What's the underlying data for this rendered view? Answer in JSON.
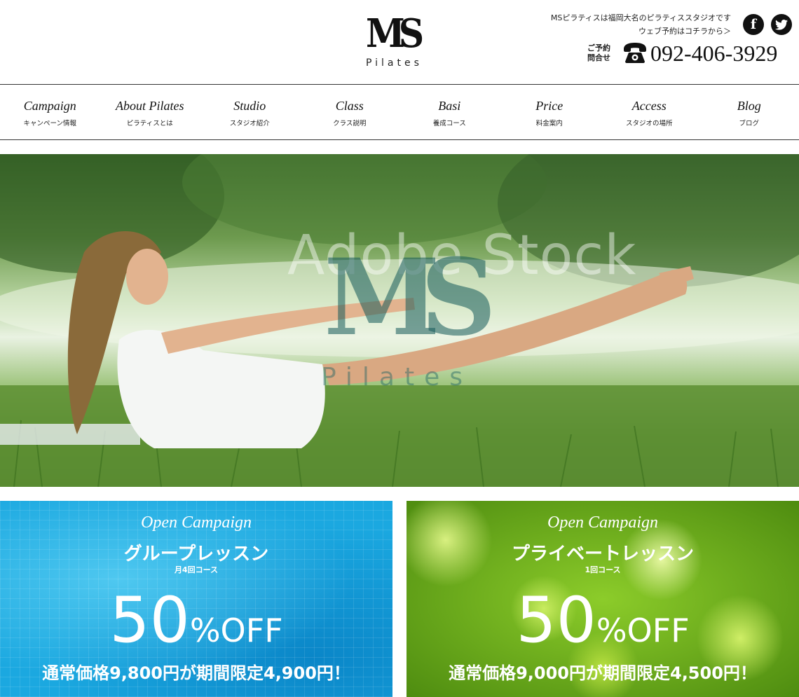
{
  "header": {
    "logo": {
      "mark": "MS",
      "sub": "Pilates"
    },
    "tagline": "MSピラティスは福岡大名のピラティススタジオです",
    "reserve_link": "ウェブ予約はコチラから＞",
    "contact_label_1": "ご予約",
    "contact_label_2": "問合せ",
    "phone": "092-406-3929",
    "social": {
      "facebook": "f",
      "twitter_icon": "twitter-bird"
    }
  },
  "nav": [
    {
      "en": "Campaign",
      "ja": "キャンペーン情報"
    },
    {
      "en": "About Pilates",
      "ja": "ピラティスとは"
    },
    {
      "en": "Studio",
      "ja": "スタジオ紹介"
    },
    {
      "en": "Class",
      "ja": "クラス説明"
    },
    {
      "en": "Basi",
      "ja": "養成コース"
    },
    {
      "en": "Price",
      "ja": "料金案内"
    },
    {
      "en": "Access",
      "ja": "スタジオの場所"
    },
    {
      "en": "Blog",
      "ja": "ブログ"
    }
  ],
  "hero": {
    "watermark": "Adobe Stock",
    "logo_mark": "MS",
    "logo_sub": "Pilates"
  },
  "banners": [
    {
      "campaign": "Open Campaign",
      "lesson": "グループレッスン",
      "course": "月4回コース",
      "percent": "50",
      "off": "%OFF",
      "price": "通常価格9,800円が期間限定4,900円！"
    },
    {
      "campaign": "Open Campaign",
      "lesson": "プライベートレッスン",
      "course": "1回コース",
      "percent": "50",
      "off": "%OFF",
      "price": "通常価格9,000円が期間限定4,500円！"
    }
  ],
  "colors": {
    "blue_banner": "#1ba8e0",
    "green_banner": "#7fbf1f",
    "text": "#111111"
  }
}
